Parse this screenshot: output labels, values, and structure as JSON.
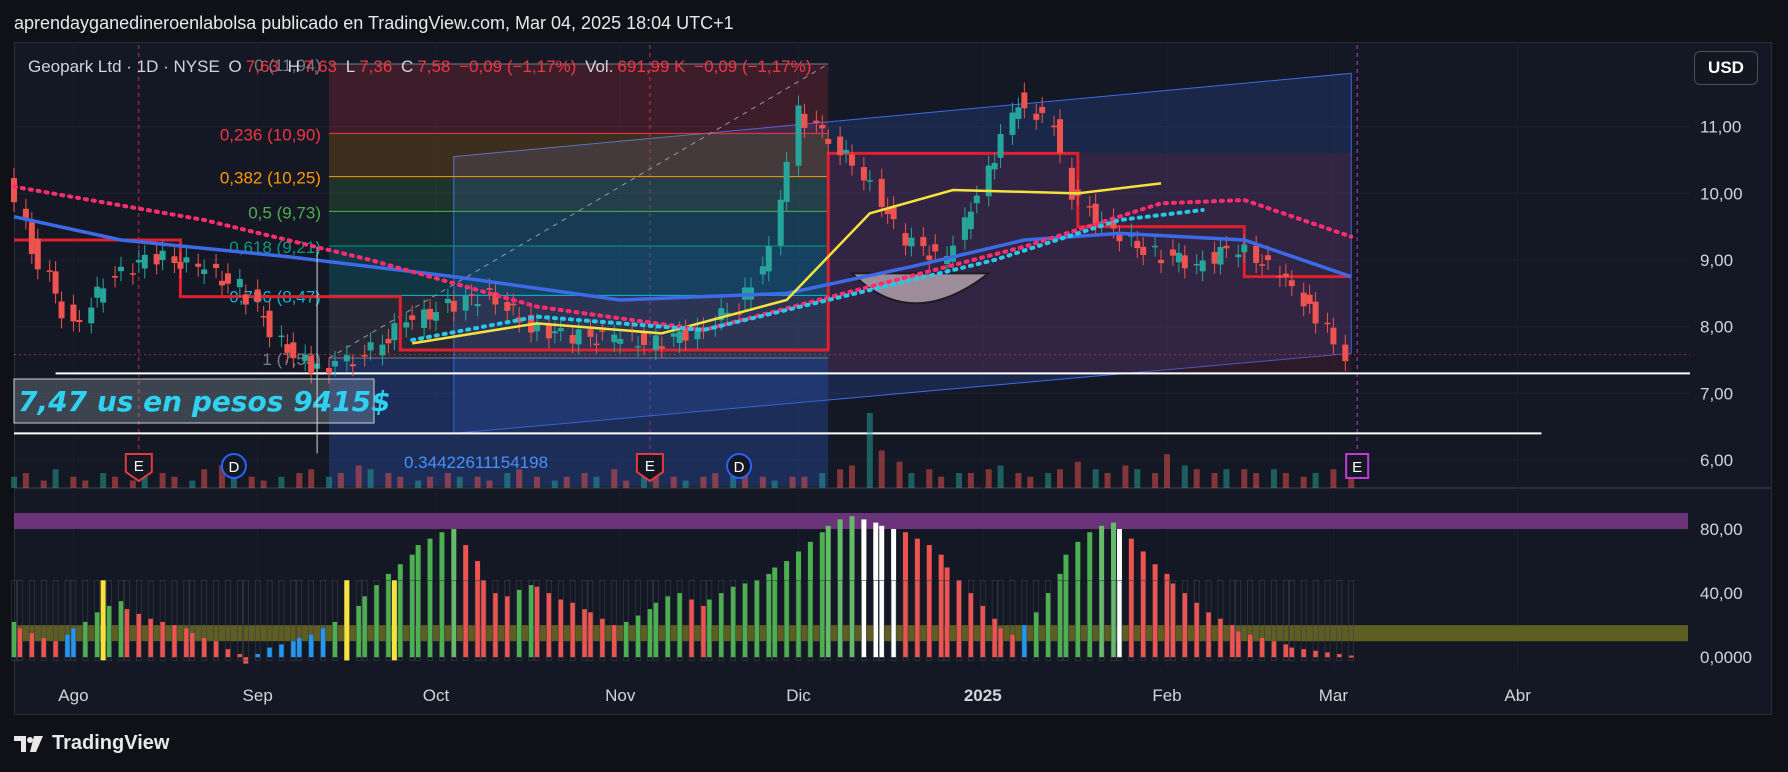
{
  "header": {
    "publisher_line": "aprendayganedineroenlabolsa publicado en TradingView.com, Mar 04, 2025 18:04 UTC+1"
  },
  "legend": {
    "symbol": "Geopark Ltd · 1D · NYSE",
    "open_label": "O",
    "open_value": "7,63",
    "high_label": "H",
    "high_value": "7,63",
    "low_label": "L",
    "low_value": "7,36",
    "close_label": "C",
    "close_value": "7,58",
    "change": "−0,09 (−1,17%)",
    "vol_label": "Vol.",
    "vol_value": "691,99 K",
    "vol_change": "−0,09 (−1,17%)"
  },
  "currency_button": "USD",
  "footer": {
    "brand": "TradingView"
  },
  "colors": {
    "bull": "#26a69a",
    "bear": "#ef5350",
    "ma_blue": "#3d6be8",
    "ma_yellow": "#f5e23d",
    "ma_red_dots": "#ff2d6f",
    "ma_cyan_dots": "#29c7e6",
    "step_red": "#e0202e",
    "purple_band": "#7a3a8a",
    "olive_band": "#6b6a22"
  },
  "chart_data": [
    {
      "type": "candlestick",
      "title": "Geopark Ltd · 1D · NYSE",
      "ylim": [
        5.55,
        12.0
      ],
      "y_ticks": [
        "11,00",
        "10,00",
        "9,00",
        "8,00",
        "7,00",
        "6,00"
      ],
      "x_ticks": [
        "Ago",
        "Sep",
        "Oct",
        "Nov",
        "Dic",
        "2025",
        "Feb",
        "Mar",
        "Abr"
      ],
      "close_path": [
        {
          "t": "2024-07-22",
          "close": 10.15
        },
        {
          "t": "2024-07-26",
          "close": 9.2
        },
        {
          "t": "2024-08-02",
          "close": 8.0
        },
        {
          "t": "2024-08-09",
          "close": 8.8
        },
        {
          "t": "2024-08-16",
          "close": 9.05
        },
        {
          "t": "2024-08-23",
          "close": 8.9
        },
        {
          "t": "2024-08-30",
          "close": 8.6
        },
        {
          "t": "2024-09-06",
          "close": 7.8
        },
        {
          "t": "2024-09-11",
          "close": 7.35
        },
        {
          "t": "2024-09-20",
          "close": 7.55
        },
        {
          "t": "2024-09-27",
          "close": 8.05
        },
        {
          "t": "2024-10-04",
          "close": 8.3
        },
        {
          "t": "2024-10-11",
          "close": 8.5
        },
        {
          "t": "2024-10-18",
          "close": 8.0
        },
        {
          "t": "2024-10-25",
          "close": 7.85
        },
        {
          "t": "2024-11-01",
          "close": 7.85
        },
        {
          "t": "2024-11-08",
          "close": 7.75
        },
        {
          "t": "2024-11-15",
          "close": 7.95
        },
        {
          "t": "2024-11-22",
          "close": 8.3
        },
        {
          "t": "2024-11-27",
          "close": 9.1
        },
        {
          "t": "2024-11-29",
          "close": 9.8
        },
        {
          "t": "2024-12-02",
          "close": 11.2
        },
        {
          "t": "2024-12-06",
          "close": 10.9
        },
        {
          "t": "2024-12-13",
          "close": 10.3
        },
        {
          "t": "2024-12-20",
          "close": 9.3
        },
        {
          "t": "2024-12-27",
          "close": 9.0
        },
        {
          "t": "2025-01-03",
          "close": 10.3
        },
        {
          "t": "2025-01-08",
          "close": 11.4
        },
        {
          "t": "2025-01-14",
          "close": 11.0
        },
        {
          "t": "2025-01-17",
          "close": 10.0
        },
        {
          "t": "2025-01-24",
          "close": 9.4
        },
        {
          "t": "2025-01-31",
          "close": 9.1
        },
        {
          "t": "2025-02-07",
          "close": 8.95
        },
        {
          "t": "2025-02-14",
          "close": 9.2
        },
        {
          "t": "2025-02-21",
          "close": 8.8
        },
        {
          "t": "2025-02-26",
          "close": 8.3
        },
        {
          "t": "2025-03-04",
          "close": 7.58
        }
      ],
      "moving_averages": [
        {
          "style": "blue",
          "points": [
            [
              "2024-07-22",
              9.65
            ],
            [
              "2024-08-09",
              9.3
            ],
            [
              "2024-09-06",
              9.05
            ],
            [
              "2024-10-04",
              8.75
            ],
            [
              "2024-11-01",
              8.4
            ],
            [
              "2024-11-29",
              8.5
            ],
            [
              "2024-12-20",
              8.9
            ],
            [
              "2025-01-08",
              9.3
            ],
            [
              "2025-01-24",
              9.4
            ],
            [
              "2025-02-14",
              9.3
            ],
            [
              "2025-03-04",
              8.75
            ]
          ]
        },
        {
          "style": "yellow",
          "points": [
            [
              "2024-09-27",
              7.75
            ],
            [
              "2024-10-18",
              8.05
            ],
            [
              "2024-11-08",
              7.9
            ],
            [
              "2024-11-29",
              8.4
            ],
            [
              "2024-12-13",
              9.7
            ],
            [
              "2024-12-27",
              10.05
            ],
            [
              "2025-01-17",
              10.0
            ],
            [
              "2025-01-31",
              10.15
            ]
          ]
        },
        {
          "style": "red-dots",
          "points": [
            [
              "2024-07-22",
              10.1
            ],
            [
              "2024-08-23",
              9.6
            ],
            [
              "2024-09-20",
              9.0
            ],
            [
              "2024-10-18",
              8.3
            ],
            [
              "2024-11-15",
              7.95
            ],
            [
              "2024-12-13",
              8.6
            ],
            [
              "2025-01-08",
              9.2
            ],
            [
              "2025-01-31",
              9.85
            ],
            [
              "2025-02-14",
              9.9
            ],
            [
              "2025-03-04",
              9.35
            ]
          ]
        },
        {
          "style": "cyan-dots",
          "points": [
            [
              "2024-09-27",
              7.8
            ],
            [
              "2024-10-18",
              8.15
            ],
            [
              "2024-11-15",
              7.95
            ],
            [
              "2024-12-06",
              8.4
            ],
            [
              "2025-01-03",
              9.0
            ],
            [
              "2025-01-24",
              9.6
            ],
            [
              "2025-02-07",
              9.75
            ]
          ]
        }
      ],
      "fibonacci": [
        {
          "label": "0 (11,94)",
          "value": 11.94
        },
        {
          "label": "0,236 (10,90)",
          "value": 10.9
        },
        {
          "label": "0,382 (10,25)",
          "value": 10.25
        },
        {
          "label": "0,5 (9,73)",
          "value": 9.73
        },
        {
          "label": "0,618 (9,21)",
          "value": 9.21
        },
        {
          "label": "0,786 (8,47)",
          "value": 8.47
        },
        {
          "label": "1 (7,53)",
          "value": 7.53
        }
      ],
      "fib_colors": [
        "#787b86",
        "#f23645",
        "#ff9800",
        "#4caf50",
        "#089981",
        "#00bcd4",
        "#787b86"
      ],
      "fib_span": [
        "2024-09-13",
        "2024-12-06"
      ],
      "support_lines": [
        {
          "value": 7.3,
          "from": "2024-07-29",
          "to": "2025-04-30",
          "color": "#ffffff"
        },
        {
          "value": 6.4,
          "from": "2024-07-22",
          "to": "2025-04-05",
          "color": "#ffffff"
        }
      ],
      "annotations": {
        "price_note": "7,47 us  en pesos 9415$",
        "ratio_label": "0.34422611154198",
        "event_markers": [
          {
            "text": "E",
            "date": "2024-08-12",
            "kind": "earnings-past"
          },
          {
            "text": "D",
            "date": "2024-08-28",
            "kind": "dividend"
          },
          {
            "text": "E",
            "date": "2024-11-06",
            "kind": "earnings-past"
          },
          {
            "text": "D",
            "date": "2024-11-21",
            "kind": "dividend"
          },
          {
            "text": "E",
            "date": "2025-03-05",
            "kind": "earnings-next"
          }
        ]
      },
      "volume_relative": [
        3,
        4,
        2,
        5,
        3,
        2,
        4,
        3,
        2,
        3,
        4,
        3,
        2,
        5,
        6,
        4,
        3,
        2,
        3,
        4,
        5,
        3,
        4,
        6,
        5,
        4,
        3,
        2,
        3,
        4,
        3,
        3,
        2,
        4,
        5,
        3,
        2,
        3,
        4,
        3,
        5,
        2,
        3,
        4,
        3,
        2,
        3,
        4,
        5,
        4,
        3,
        2,
        3,
        3,
        4,
        5,
        6,
        20,
        10,
        7,
        4,
        5,
        3,
        4,
        4,
        5,
        6,
        4,
        3,
        4,
        5,
        7,
        5,
        4,
        6,
        5,
        4,
        9,
        6,
        5,
        4,
        5,
        5,
        4,
        5,
        4,
        3,
        4,
        5,
        6
      ]
    },
    {
      "type": "histogram",
      "title": "",
      "ylim": [
        -8,
        95
      ],
      "y_ticks": [
        "80,00",
        "40,00",
        "0,0000"
      ],
      "bands": [
        {
          "from": 80,
          "to": 90,
          "color": "#7a3a8a"
        },
        {
          "from": 10,
          "to": 20,
          "color": "#6b6a22"
        }
      ],
      "series_values": [
        22,
        18,
        15,
        12,
        10,
        14,
        18,
        22,
        28,
        32,
        35,
        30,
        27,
        24,
        22,
        20,
        18,
        15,
        12,
        10,
        5,
        2,
        -4,
        2,
        6,
        8,
        10,
        12,
        14,
        18,
        22,
        26,
        32,
        38,
        45,
        52,
        58,
        64,
        70,
        74,
        78,
        80,
        70,
        60,
        48,
        40,
        38,
        42,
        45,
        44,
        40,
        36,
        34,
        30,
        28,
        24,
        20,
        22,
        26,
        30,
        34,
        38,
        40,
        36,
        32,
        36,
        40,
        44,
        46,
        48,
        52,
        56,
        60,
        66,
        72,
        78,
        82,
        86,
        88,
        86,
        84,
        82,
        80,
        78,
        74,
        70,
        64,
        56,
        48,
        40,
        32,
        24,
        18,
        14,
        20,
        28,
        40,
        52,
        64,
        72,
        78,
        82,
        84,
        80,
        74,
        66,
        58,
        52,
        46,
        40,
        34,
        28,
        24,
        20,
        16,
        14,
        12,
        10,
        8,
        6,
        5,
        4,
        3,
        2,
        1
      ]
    }
  ]
}
